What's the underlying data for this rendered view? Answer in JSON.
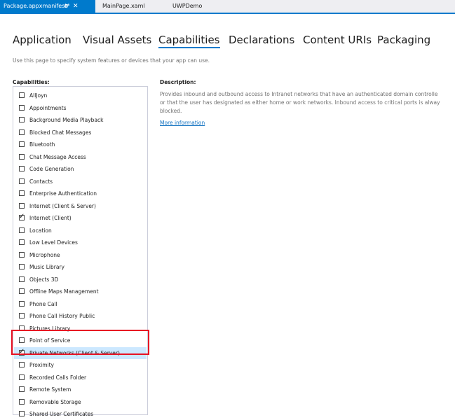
{
  "doc_tabs": {
    "active": "Package.appxmanifest*",
    "pin_glyph": "⊕",
    "close_glyph": "✕",
    "others": [
      "MainPage.xaml",
      "UWPDemo"
    ]
  },
  "manifest_tabs": [
    "Application",
    "Visual Assets",
    "Capabilities",
    "Declarations",
    "Content URIs",
    "Packaging"
  ],
  "selected_tab": "Capabilities",
  "hint": "Use this page to specify system features or devices that your app can use.",
  "capabilities": {
    "label": "Capabilities:",
    "items": [
      {
        "label": "AllJoyn",
        "checked": false
      },
      {
        "label": "Appointments",
        "checked": false
      },
      {
        "label": "Background Media Playback",
        "checked": false
      },
      {
        "label": "Blocked Chat Messages",
        "checked": false
      },
      {
        "label": "Bluetooth",
        "checked": false
      },
      {
        "label": "Chat Message Access",
        "checked": false
      },
      {
        "label": "Code Generation",
        "checked": false
      },
      {
        "label": "Contacts",
        "checked": false
      },
      {
        "label": "Enterprise Authentication",
        "checked": false
      },
      {
        "label": "Internet (Client & Server)",
        "checked": false
      },
      {
        "label": "Internet (Client)",
        "checked": true
      },
      {
        "label": "Location",
        "checked": false
      },
      {
        "label": "Low Level Devices",
        "checked": false
      },
      {
        "label": "Microphone",
        "checked": false
      },
      {
        "label": "Music Library",
        "checked": false
      },
      {
        "label": "Objects 3D",
        "checked": false
      },
      {
        "label": "Offline Maps Management",
        "checked": false
      },
      {
        "label": "Phone Call",
        "checked": false
      },
      {
        "label": "Phone Call History Public",
        "checked": false
      },
      {
        "label": "Pictures Library",
        "checked": false
      },
      {
        "label": "Point of Service",
        "checked": false
      },
      {
        "label": "Private Networks (Client & Server)",
        "checked": true,
        "selected": true
      },
      {
        "label": "Proximity",
        "checked": false
      },
      {
        "label": "Recorded Calls Folder",
        "checked": false
      },
      {
        "label": "Remote System",
        "checked": false
      },
      {
        "label": "Removable Storage",
        "checked": false
      },
      {
        "label": "Shared User Certificates",
        "checked": false
      }
    ]
  },
  "description": {
    "label": "Description:",
    "lines": [
      "Provides inbound and outbound access to Intranet networks that have an authenticated domain controlle",
      "or that the user has designated as either home or work networks. Inbound access to critical ports is alway",
      "blocked."
    ],
    "link": "More information"
  },
  "colors": {
    "accent": "#007acc",
    "highlight_border": "#e81123",
    "selection": "#cce8ff",
    "link": "#0e70c0"
  }
}
